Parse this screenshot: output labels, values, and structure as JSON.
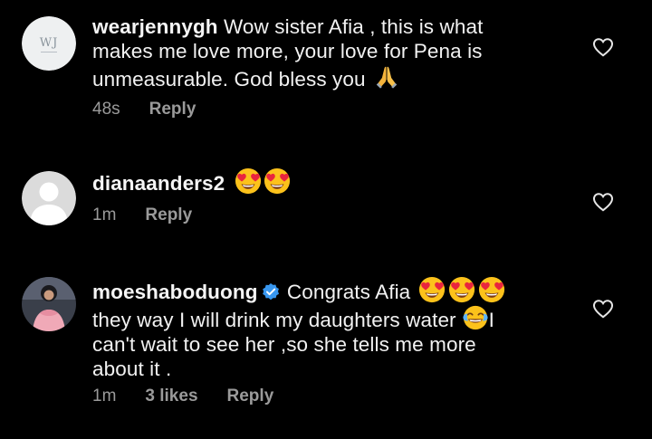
{
  "comments": [
    {
      "username": "wearjennygh",
      "avatar": "wj-logo-avatar",
      "avatar_text": "WJ",
      "verified": false,
      "text": "Wow sister Afia , this is what makes me love more, your love for Pena is unmeasurable. God bless you",
      "emojis": [
        "folded-hands-emoji"
      ],
      "time": "48s",
      "likes": "",
      "reply_label": "Reply",
      "liked": false
    },
    {
      "username": "dianaanders2",
      "avatar": "default-profile-avatar",
      "verified": false,
      "text": "",
      "emojis": [
        "heart-eyes-emoji",
        "heart-eyes-emoji"
      ],
      "time": "1m",
      "likes": "",
      "reply_label": "Reply",
      "liked": false
    },
    {
      "username": "moeshaboduong",
      "avatar": "profile-photo-avatar",
      "verified": true,
      "text_part1": "Congrats Afia",
      "text_part2_line1": "they way I will drink my daughters water",
      "text_part2_rest": "I can't wait to see her ,so she tells me more about it .",
      "emojis": [
        "heart-eyes-emoji",
        "heart-eyes-emoji",
        "heart-eyes-emoji",
        "tears-of-joy-emoji"
      ],
      "time": "1m",
      "likes": "3 likes",
      "reply_label": "Reply",
      "liked": false
    }
  ],
  "colors": {
    "background": "#000000",
    "text": "#f2f2f2",
    "meta": "#9a9a9a",
    "verified": "#3897f0",
    "emoji_face": "#fcc21b",
    "emoji_heart": "#e9253e"
  }
}
